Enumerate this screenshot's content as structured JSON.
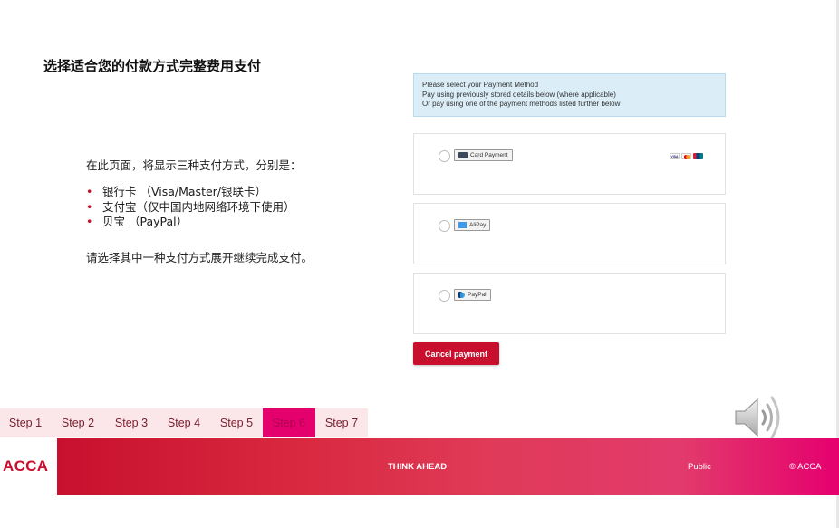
{
  "slide": {
    "title": "选择适合您的付款方式完整费用支付",
    "intro": "在此页面，将显示三种支付方式，分别是：",
    "methods": [
      "银行卡 （Visa/Master/银联卡）",
      "支付宝（仅中国内地网络环境下使用）",
      "贝宝 （PayPal）"
    ],
    "instruction": "请选择其中一种支付方式展开继续完成支付。"
  },
  "payment_page": {
    "info_lines": [
      "Please select your Payment Method",
      "Pay using previously stored details below (where applicable)",
      "Or pay using one of the payment methods listed further below"
    ],
    "options": [
      {
        "label": "Card Payment",
        "icon": "card-icon",
        "brands": [
          "VISA",
          "mastercard",
          "unionpay"
        ]
      },
      {
        "label": "AliPay",
        "icon": "alipay-icon"
      },
      {
        "label": "PayPal",
        "icon": "paypal-icon"
      }
    ],
    "cancel_label": "Cancel payment"
  },
  "steps": {
    "items": [
      "Step 1",
      "Step 2",
      "Step 3",
      "Step 4",
      "Step 5",
      "Step 6",
      "Step 7"
    ],
    "active_index": 5
  },
  "footer": {
    "logo": "ACCA",
    "tagline": "THINK AHEAD",
    "classification": "Public",
    "copyright": "© ACCA"
  },
  "colors": {
    "brand_red": "#c8102e",
    "brand_pink": "#e5006e",
    "step_bg": "#fbe6ea",
    "info_bg": "#dbeef8"
  },
  "icons": {
    "speaker": "speaker-icon"
  }
}
